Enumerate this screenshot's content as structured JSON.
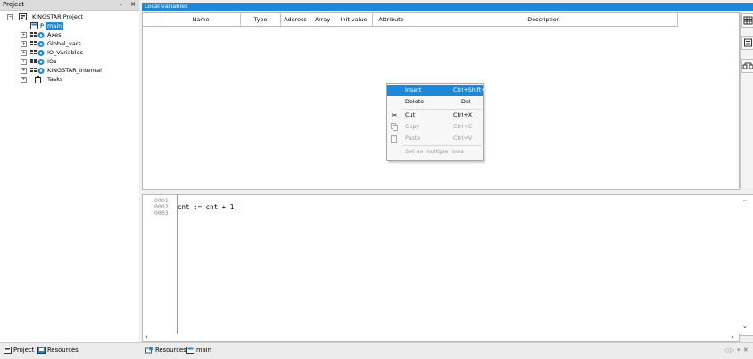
{
  "project_panel": {
    "title": "Project",
    "pin_glyph": "⊧",
    "close_glyph": "×",
    "tree": [
      {
        "label": "KINGSTAR Project",
        "expander": "⊟",
        "icon": "project-icon"
      },
      {
        "label": "main",
        "prefix": "P",
        "icon": "program-icon",
        "selected": true
      },
      {
        "label": "Axes",
        "expander": "+",
        "icon": "group-icon"
      },
      {
        "label": "Global_vars",
        "expander": "+",
        "icon": "group-icon"
      },
      {
        "label": "IO_Variables",
        "expander": "+",
        "icon": "group-icon"
      },
      {
        "label": "IOs",
        "expander": "+",
        "icon": "group-icon"
      },
      {
        "label": "KINGSTAR_Internal",
        "expander": "+",
        "icon": "group-icon"
      },
      {
        "label": "Tasks",
        "expander": "+",
        "icon": "tasks-icon"
      }
    ]
  },
  "bottom_tabs_left": [
    {
      "label": "Project",
      "icon": "project-icon"
    },
    {
      "label": "Resources",
      "icon": "resources-icon"
    }
  ],
  "bottom_tabs_right": [
    {
      "label": "Resources",
      "icon": "resources-icon"
    },
    {
      "label": "main",
      "icon": "program-icon"
    }
  ],
  "bottom_nav": {
    "left": "◁",
    "right": "▷",
    "down": "▾",
    "close": "✕"
  },
  "local_variables": {
    "title": "Local variables",
    "columns": [
      "Name",
      "Type",
      "Address",
      "Array",
      "Init value",
      "Attribute",
      "Description"
    ]
  },
  "context_menu": {
    "items": [
      {
        "label": "Insert",
        "shortcut": "Ctrl+Shift+Ins",
        "state": "highlighted"
      },
      {
        "label": "Delete",
        "shortcut": "Del",
        "state": "enabled"
      },
      {
        "label": "Cut",
        "shortcut": "Ctrl+X",
        "state": "enabled",
        "icon": "scissors-icon"
      },
      {
        "label": "Copy",
        "shortcut": "Ctrl+C",
        "state": "disabled",
        "icon": "copy-icon"
      },
      {
        "label": "Paste",
        "shortcut": "Ctrl+V",
        "state": "disabled",
        "icon": "paste-icon"
      },
      {
        "label": "Set on multiple rows",
        "shortcut": "",
        "state": "disabled"
      }
    ]
  },
  "editor": {
    "line_numbers": [
      "0001",
      "0002",
      "0003"
    ],
    "code_lines": [
      "",
      "cnt := cnt + 1;",
      ""
    ]
  },
  "colors": {
    "accent": "#1e88d8"
  }
}
